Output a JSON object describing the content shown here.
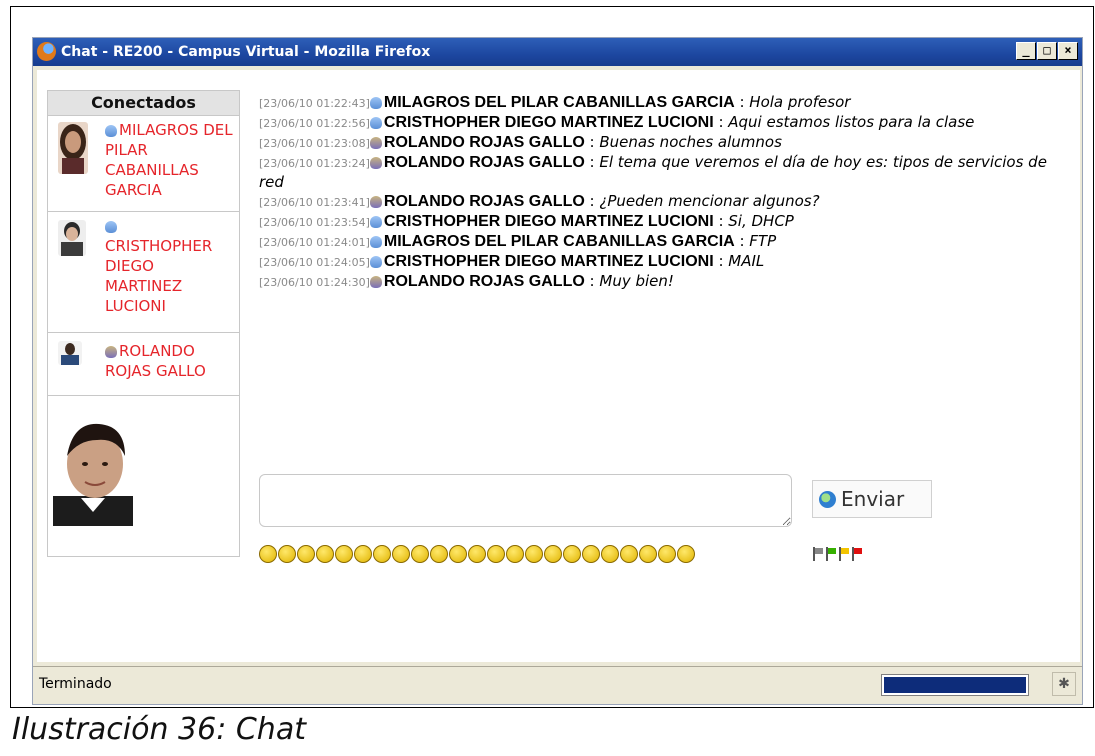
{
  "window": {
    "title": "Chat - RE200 - Campus Virtual - Mozilla Firefox",
    "minimize": "_",
    "maximize": "□",
    "close": "×"
  },
  "sidebar": {
    "header": "Conectados",
    "users": [
      {
        "name": "MILAGROS DEL PILAR CABANILLAS GARCIA",
        "role": "student"
      },
      {
        "name": "CRISTHOPHER DIEGO MARTINEZ LUCIONI",
        "role": "student"
      },
      {
        "name": "ROLANDO ROJAS GALLO",
        "role": "teacher"
      }
    ]
  },
  "messages": [
    {
      "time": "[23/06/10 01:22:43]",
      "name": "MILAGROS DEL PILAR CABANILLAS GARCIA",
      "sep": " : ",
      "text": "Hola profesor"
    },
    {
      "time": "[23/06/10 01:22:56]",
      "name": "CRISTHOPHER DIEGO MARTINEZ LUCIONI",
      "sep": " : ",
      "text": "Aqui estamos listos para la clase"
    },
    {
      "time": "[23/06/10 01:23:08]",
      "name": "ROLANDO ROJAS GALLO",
      "sep": " : ",
      "text": "Buenas noches alumnos"
    },
    {
      "time": "[23/06/10 01:23:24]",
      "name": "ROLANDO ROJAS GALLO",
      "sep": " : ",
      "text": "El tema que veremos el día de hoy es: tipos de servicios de red"
    },
    {
      "time": "[23/06/10 01:23:41]",
      "name": "ROLANDO ROJAS GALLO",
      "sep": " : ",
      "text": "¿Pueden mencionar algunos?"
    },
    {
      "time": "[23/06/10 01:23:54]",
      "name": "CRISTHOPHER DIEGO MARTINEZ LUCIONI",
      "sep": " : ",
      "text": "Si, DHCP"
    },
    {
      "time": "[23/06/10 01:24:01]",
      "name": "MILAGROS DEL PILAR CABANILLAS GARCIA",
      "sep": " : ",
      "text": "FTP"
    },
    {
      "time": "[23/06/10 01:24:05]",
      "name": "CRISTHOPHER DIEGO MARTINEZ LUCIONI",
      "sep": " : ",
      "text": "MAIL"
    },
    {
      "time": "[23/06/10 01:24:30]",
      "name": "ROLANDO ROJAS GALLO",
      "sep": " : ",
      "text": "Muy bien!"
    }
  ],
  "composer": {
    "send_label": "Enviar",
    "input_value": ""
  },
  "statusbar": {
    "text": "Terminado",
    "progress": 1.0
  },
  "caption": "Ilustración 36: Chat"
}
